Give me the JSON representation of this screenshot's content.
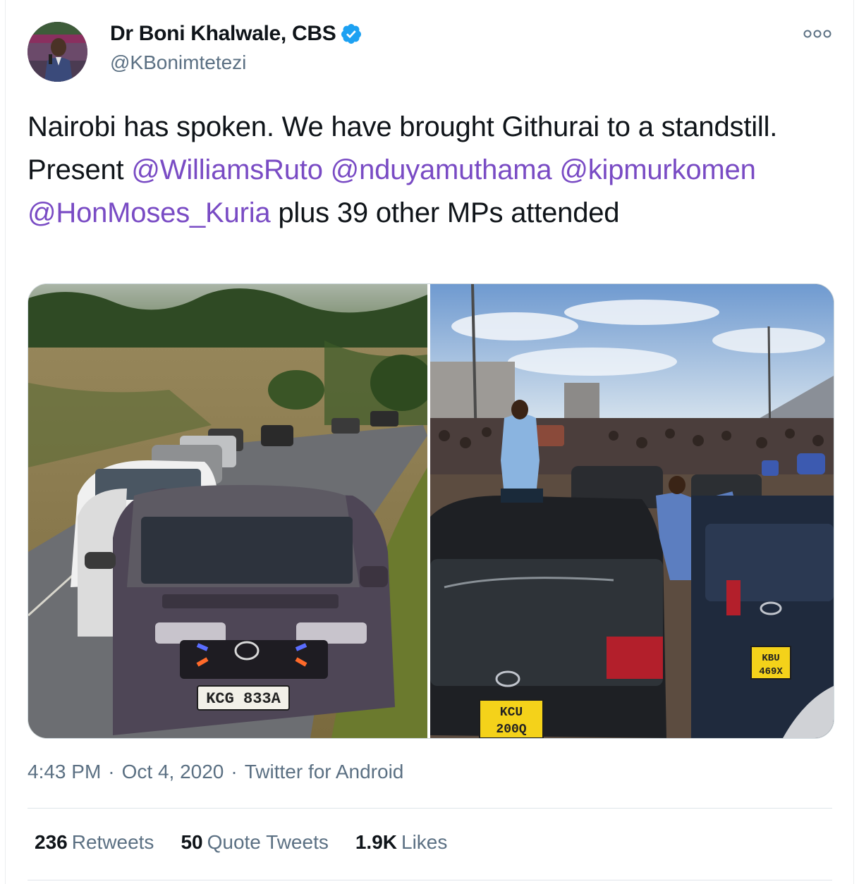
{
  "author": {
    "name": "Dr Boni Khalwale, CBS",
    "handle": "@KBonimtetezi",
    "verified": true,
    "avatar_icon": "profile-avatar"
  },
  "tweet": {
    "text_parts": [
      {
        "t": "Nairobi has spoken. We have brought Githurai to a standstill. Present ",
        "mention": false
      },
      {
        "t": "@WilliamsRuto",
        "mention": true
      },
      {
        "t": " ",
        "mention": false
      },
      {
        "t": "@nduyamuthama",
        "mention": true
      },
      {
        "t": " ",
        "mention": false
      },
      {
        "t": "@kipmurkomen",
        "mention": true
      },
      {
        "t": " ",
        "mention": false
      },
      {
        "t": "@HonMoses_Kuria",
        "mention": true
      },
      {
        "t": " plus 39 other MPs attended",
        "mention": false
      }
    ],
    "mention_color": "#794bc4"
  },
  "media": {
    "photo1": {
      "plate": "KCG 833A"
    },
    "photo2": {
      "plate_left_1": "KCU",
      "plate_left_2": "200Q",
      "plate_right_1": "KBU",
      "plate_right_2": "469X"
    }
  },
  "meta": {
    "time": "4:43 PM",
    "sep1": "·",
    "date": "Oct 4, 2020",
    "sep2": "·",
    "source": "Twitter for Android"
  },
  "stats": [
    {
      "num": "236",
      "label": "Retweets"
    },
    {
      "num": "50",
      "label": "Quote Tweets"
    },
    {
      "num": "1.9K",
      "label": "Likes"
    }
  ],
  "colors": {
    "text": "#0f1419",
    "secondary": "#5b7083",
    "verified": "#1da1f2"
  }
}
